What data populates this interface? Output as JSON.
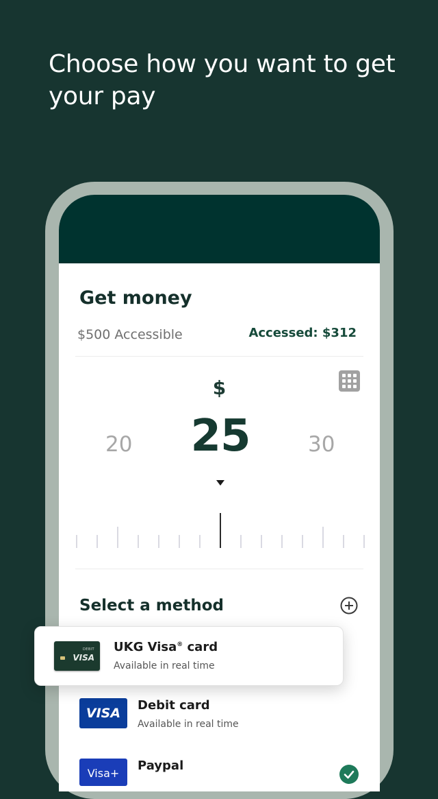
{
  "headline": "Choose how you want to get your pay",
  "screen": {
    "title": "Get money",
    "accessible_text": "$500 Accessible",
    "accessed_text": "Accessed: $312",
    "currency_symbol": "$",
    "amount_prev": "20",
    "amount_current": "25",
    "amount_next": "30"
  },
  "methods": {
    "section_title": "Select a method",
    "add_icon": "plus-circle-icon",
    "items": [
      {
        "icon_text_top": "DEBIT",
        "icon_text": "VISA",
        "name_main": "UKG Visa",
        "name_mark": "®",
        "name_suffix": " card",
        "subtitle": "Available in real time"
      },
      {
        "icon_text": "VISA",
        "name": "Debit card",
        "subtitle": "Available in real time"
      },
      {
        "icon_text": "Visa+",
        "name": "Paypal",
        "selected": true
      }
    ]
  },
  "colors": {
    "background": "#173530",
    "phone_header": "#00332f",
    "accent": "#164a3a",
    "visa_blue": "#0a3d9b",
    "check_green": "#1e7a5a"
  }
}
